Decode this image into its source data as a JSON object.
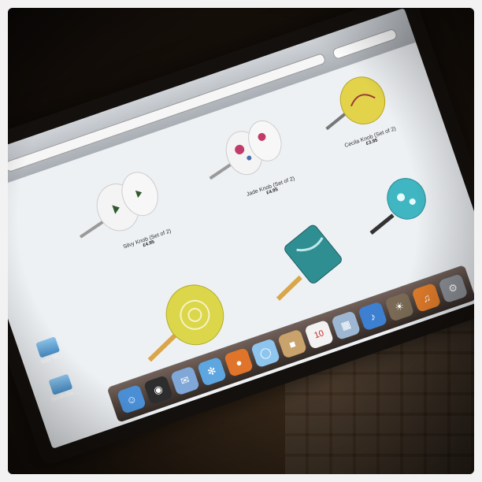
{
  "products": [
    {
      "name": "Silvy Knob (Set of 2)",
      "price": "£4.95"
    },
    {
      "name": "Jade Knob (Set of 2)",
      "price": "£4.95"
    },
    {
      "name": "Cecila Knob (Set of 2)",
      "price": "£3.95"
    }
  ],
  "desktop_icons": [
    {
      "label": "Italy Tri..."
    },
    {
      "label": "South Da..."
    }
  ],
  "dock": {
    "items": [
      "finder-icon",
      "dashboard-icon",
      "mail-icon",
      "safari-icon",
      "firefox-icon",
      "ichat-icon",
      "address-book-icon",
      "ical-icon",
      "preview-icon",
      "itunes-icon",
      "iphoto-icon",
      "garageband-icon",
      "system-preferences-icon",
      "time-machine-icon",
      "trash-icon"
    ],
    "ical_day": "10"
  },
  "colors": {
    "screen": "#e9edf1",
    "knob_yellow": "#e2d34a",
    "knob_teal": "#3fb6c2",
    "knob_white": "#f4f4f4"
  }
}
